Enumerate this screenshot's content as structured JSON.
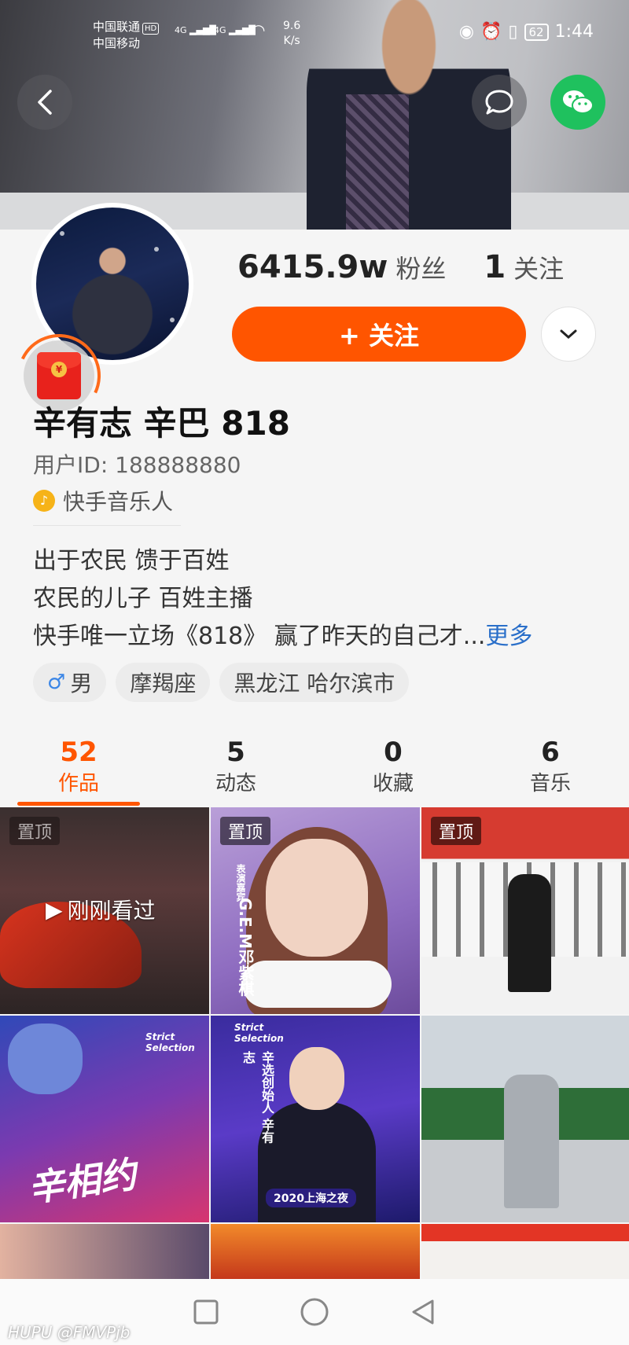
{
  "status_bar": {
    "carrier1": "中国联通",
    "carrier_badge": "HD",
    "carrier2": "中国移动",
    "signal1": "4G",
    "signal2": "4G",
    "net_speed_value": "9.6",
    "net_speed_unit": "K/s",
    "battery": "62",
    "time": "1:44"
  },
  "header": {
    "back_icon": "chevron-left-icon",
    "comment_icon": "chat-bubble-icon",
    "share_icon": "wechat-icon",
    "wechat_color": "#1fc15e"
  },
  "profile": {
    "followers_count": "6415.9w",
    "followers_label": "粉丝",
    "following_count": "1",
    "following_label": "关注",
    "follow_button": "+ 关注",
    "name": "辛有志 辛巴 818",
    "user_id": "用户ID: 188888880",
    "badge": "快手音乐人",
    "bio_line1": "出于农民 馈于百姓",
    "bio_line2": "农民的儿子  百姓主播",
    "bio_line3": "快手唯一立场《818》 赢了昨天的自己才...",
    "bio_more": "更多",
    "tags": {
      "gender_symbol": "♂",
      "gender": "男",
      "zodiac": "摩羯座",
      "location": "黑龙江 哈尔滨市"
    },
    "accent_color": "#ff5500"
  },
  "tabs": [
    {
      "count": "52",
      "label": "作品"
    },
    {
      "count": "5",
      "label": "动态"
    },
    {
      "count": "0",
      "label": "收藏"
    },
    {
      "count": "6",
      "label": "音乐"
    }
  ],
  "grid": {
    "pinned_label": "置顶",
    "watched_label": "刚刚看过",
    "c2_side_text": "G.E.M邓紫棋",
    "c2_small_text": "表演嘉宾",
    "c4_text": "辛相约",
    "c4_tag": "Strict Selection",
    "c5_tag": "Strict Selection",
    "c5_side_text": "辛选创始人 辛有志",
    "c5_event": "2020上海之夜"
  },
  "watermark": "HUPU @FMVPjb"
}
